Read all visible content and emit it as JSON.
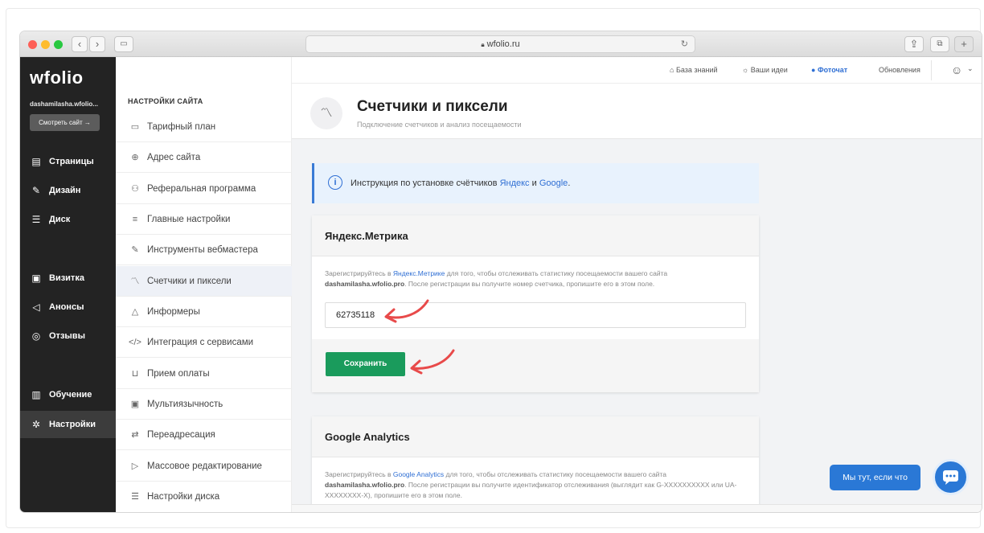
{
  "browser": {
    "url": "wfolio.ru",
    "lock_icon": "lock-icon",
    "reload_icon": "reload-icon",
    "plus_label": "+"
  },
  "sidebar": {
    "logo": "wfolio",
    "account": "dashamilasha.wfolio...",
    "view_site": "Смотреть сайт →",
    "items": [
      {
        "label": "Страницы",
        "icon": "page-icon"
      },
      {
        "label": "Дизайн",
        "icon": "brush-icon"
      },
      {
        "label": "Диск",
        "icon": "database-icon"
      },
      {
        "label": "Визитка",
        "icon": "id-card-icon"
      },
      {
        "label": "Анонсы",
        "icon": "megaphone-icon"
      },
      {
        "label": "Отзывы",
        "icon": "chat-bubbles-icon"
      },
      {
        "label": "Обучение",
        "icon": "book-icon"
      },
      {
        "label": "Настройки",
        "icon": "gear-icon"
      }
    ]
  },
  "settings_menu": {
    "title": "НАСТРОЙКИ САЙТА",
    "items": [
      {
        "label": "Тарифный план",
        "icon": "card-icon"
      },
      {
        "label": "Адрес сайта",
        "icon": "globe-icon"
      },
      {
        "label": "Реферальная программа",
        "icon": "users-icon"
      },
      {
        "label": "Главные настройки",
        "icon": "sliders-icon"
      },
      {
        "label": "Инструменты вебмастера",
        "icon": "wrench-icon"
      },
      {
        "label": "Счетчики и пиксели",
        "icon": "analytics-icon"
      },
      {
        "label": "Информеры",
        "icon": "bell-icon"
      },
      {
        "label": "Интеграция с сервисами",
        "icon": "code-icon"
      },
      {
        "label": "Прием оплаты",
        "icon": "cart-icon"
      },
      {
        "label": "Мультиязычность",
        "icon": "language-icon"
      },
      {
        "label": "Переадресация",
        "icon": "redirect-icon"
      },
      {
        "label": "Массовое редактирование",
        "icon": "bulk-edit-icon"
      },
      {
        "label": "Настройки диска",
        "icon": "disk-icon"
      }
    ]
  },
  "topnav": {
    "knowledge": "База знаний",
    "ideas": "Ваши идеи",
    "photochat": "Фоточат",
    "updates": "Обновления"
  },
  "page": {
    "title": "Счетчики и пиксели",
    "subtitle": "Подключение счетчиков и анализ посещаемости"
  },
  "info": {
    "text_before": "Инструкция по установке счётчиков ",
    "link_yandex": "Яндекс",
    "text_and": " и ",
    "link_google": "Google",
    "text_end": "."
  },
  "yandex": {
    "title": "Яндекс.Метрика",
    "desc_1": "Зарегистрируйтесь в ",
    "desc_link": "Яндекс.Метрике",
    "desc_2": " для того, чтобы отслеживать статистику посещаемости вашего сайта",
    "desc_domain": "dashamilasha.wfolio.pro",
    "desc_3": ". После регистрации вы получите номер счетчика, пропишите его в этом поле.",
    "counter_value": "62735118",
    "save_label": "Сохранить"
  },
  "google": {
    "title": "Google Analytics",
    "desc_1": "Зарегистрируйтесь в ",
    "desc_link": "Google Analytics",
    "desc_2": " для того, чтобы отслеживать статистику посещаемости вашего сайта",
    "desc_domain": "dashamilasha.wfolio.pro",
    "desc_3": ". После регистрации вы получите идентификатор отслеживания (выглядит как G-XXXXXXXXXX или UA-XXXXXXXX-X), пропишите его в этом поле."
  },
  "chat": {
    "label": "Мы тут, если что"
  },
  "colors": {
    "accent": "#2a78d6",
    "save": "#1a9b5c",
    "arrow": "#e84a4a",
    "sidebar": "#232323"
  }
}
